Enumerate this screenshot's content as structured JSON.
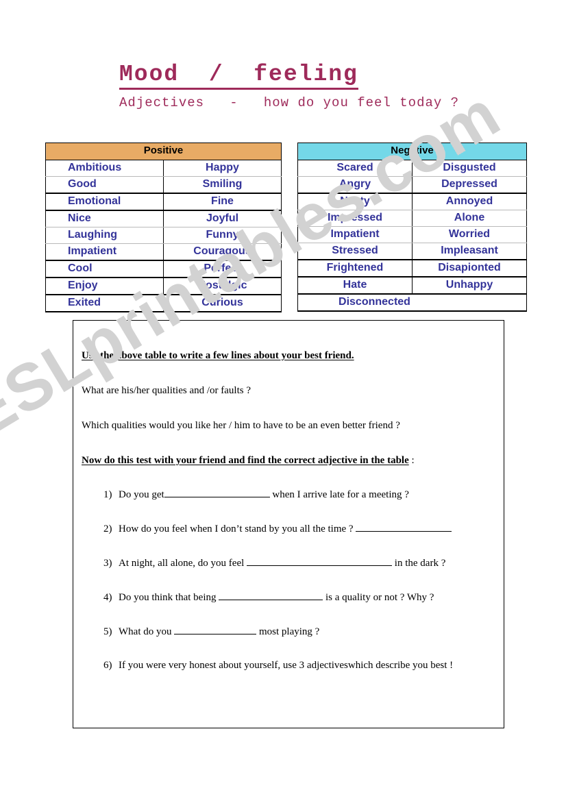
{
  "watermark": {
    "text": "ESLprintables.com"
  },
  "header": {
    "title": "Mood  /  feeling",
    "subtitle": "Adjectives   -   how do you feel today ?",
    "title_color": "#9e2a5a"
  },
  "tables": {
    "positive": {
      "header": "Positive",
      "header_bg": "#e08b29",
      "text_color": "#333399",
      "rows": [
        {
          "left": "Ambitious",
          "right": "Happy"
        },
        {
          "left": "Good",
          "right": "Smiling"
        },
        {
          "left": "Emotional",
          "right": "Fine"
        },
        {
          "left": "Nice",
          "right": "Joyful"
        },
        {
          "left": "Laughing",
          "right": "Funny"
        },
        {
          "left": "Impatient",
          "right": "Couragous"
        },
        {
          "left": "Cool",
          "right": "Perfect"
        },
        {
          "left": "Enjoy",
          "right": "Nostalgic"
        },
        {
          "left": "Exited",
          "right": "Curious"
        }
      ]
    },
    "negative": {
      "header": "Negative",
      "header_bg": "#35c6dd",
      "text_color": "#333399",
      "rows": [
        {
          "left": "Scared",
          "right": "Disgusted"
        },
        {
          "left": "Angry",
          "right": "Depressed"
        },
        {
          "left": "Nasty",
          "right": "Annoyed"
        },
        {
          "left": "Impressed",
          "right": "Alone"
        },
        {
          "left": "Impatient",
          "right": "Worried"
        },
        {
          "left": "Stressed",
          "right": "Impleasant"
        },
        {
          "left": "Frightened",
          "right": "Disapionted"
        },
        {
          "left": "Hate",
          "right": "Unhappy"
        }
      ],
      "last_row_span": "Disconnected"
    }
  },
  "exercise": {
    "instruction_1": "Use the above table to write a few lines about your best friend.",
    "prompt_1": "What are his/her qualities and /or faults ?",
    "prompt_2": "Which qualities would you like her / him to have to be an even better friend ?",
    "instruction_2": "Now do this test with your friend and find the correct adjective in the table",
    "instruction_2_trailing": " :",
    "questions": [
      {
        "num": "1)",
        "before": "Do you get",
        "after": " when I arrive late for a meeting ?",
        "blank": "w1"
      },
      {
        "num": "2)",
        "before": "How do you feel when I don’t stand by you all the time ? ",
        "after": "",
        "blank": "w2"
      },
      {
        "num": "3)",
        "before": "At night, all alone, do you feel ",
        "after": " in the dark ?",
        "blank": "w3"
      },
      {
        "num": "4)",
        "before": "Do you think that being ",
        "after": " is a quality or not ? Why ?",
        "blank": "w4"
      },
      {
        "num": "5)",
        "before": "What do you ",
        "after": " most playing ?",
        "blank": "w5"
      },
      {
        "num": "6)",
        "before": "If you were very honest about yourself, use 3 adjectiveswhich describe you best !",
        "after": "",
        "blank": ""
      }
    ]
  }
}
